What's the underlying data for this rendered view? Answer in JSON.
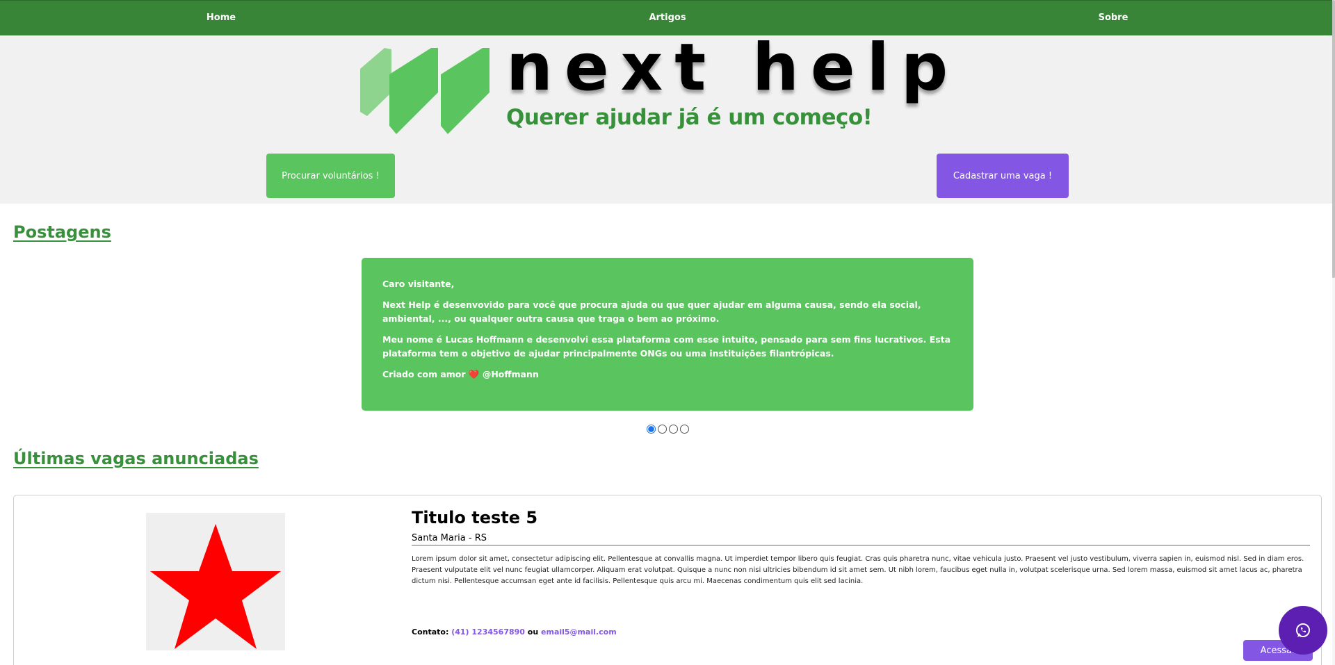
{
  "nav": {
    "items": [
      {
        "label": "Home"
      },
      {
        "label": "Artigos"
      },
      {
        "label": "Sobre"
      }
    ]
  },
  "hero": {
    "brand": "next help",
    "tagline": "Querer ajudar já é um começo!",
    "volunteers_button": "Procurar voluntários !",
    "register_button": "Cadastrar uma vaga !"
  },
  "posts": {
    "title": "Postagens",
    "slide": {
      "greeting": "Caro visitante,",
      "paragraph1": "Next Help é desenvovido para você que procura ajuda ou que quer ajudar em alguma causa, sendo ela social, ambiental, ..., ou qualquer outra causa que traga o bem ao próximo.",
      "paragraph2": "Meu nome é Lucas Hoffmann e desenvolvi essa plataforma com esse intuito, pensado para sem fins lucrativos. Esta plataforma tem o objetivo de ajudar principalmente ONGs ou uma instituições filantrópicas.",
      "signature_prefix": "Criado com amor",
      "signature_heart": "❤️",
      "signature_handle": "@Hoffmann"
    },
    "carousel": {
      "total_slides": 4,
      "active_index": 0
    }
  },
  "jobs": {
    "title": "Últimas vagas anunciadas",
    "items": [
      {
        "title": "Titulo teste 5",
        "location": "Santa Maria - RS",
        "description": "Lorem ipsum dolor sit amet, consectetur adipiscing elit. Pellentesque at convallis magna. Ut imperdiet tempor libero quis feugiat. Cras quis pharetra nunc, vitae vehicula justo. Praesent vel justo vestibulum, viverra sapien in, euismod nisl. Sed in diam eros. Praesent vulputate elit vel nunc feugiat ullamcorper. Aliquam erat volutpat. Quisque a nunc non nisi ultricies bibendum id sit amet sem. Ut nibh lorem, faucibus eget nulla in, volutpat scelerisque urna. Sed lorem massa, euismod sit amet lacus ac, pharetra dictum nisi. Pellentesque accumsan eget ante id facilisis. Pellentesque quis arcu mi. Maecenas condimentum quis elit sed lacinia.",
        "contact_label": "Contato:",
        "phone": "(41) 1234567890",
        "contact_separator": "ou",
        "email": "email5@mail.com",
        "access_button": "Acessar",
        "image_icon": "red-star"
      }
    ]
  },
  "fab": {
    "icon": "whatsapp-icon"
  },
  "colors": {
    "nav_bg": "#388538",
    "hero_bg": "#f1f1f1",
    "green_accent": "#37913b",
    "green_button": "#5ac55e",
    "purple_button": "#8357e4",
    "fab_bg": "#5d1fb2",
    "star_red": "#ff0000"
  }
}
